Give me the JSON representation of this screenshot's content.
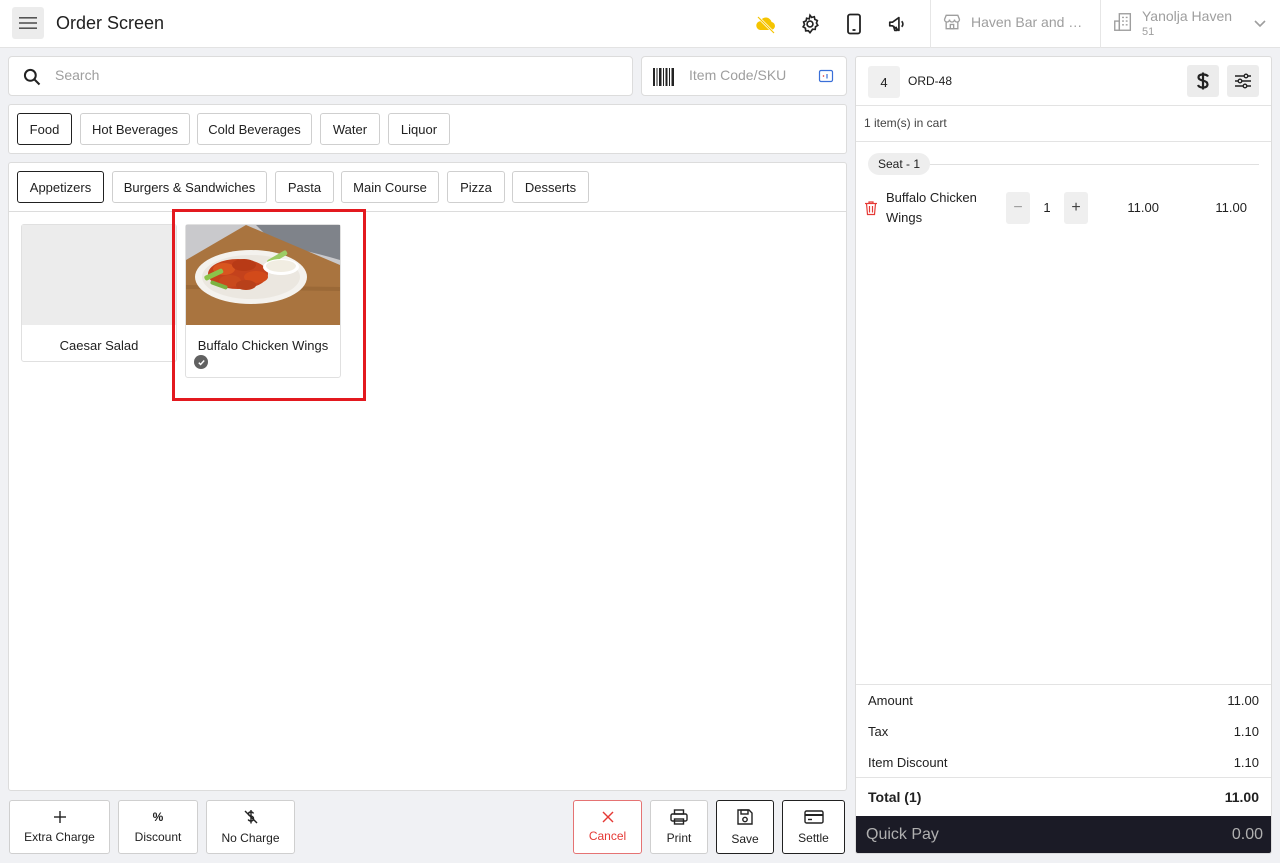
{
  "header": {
    "title": "Order Screen",
    "store_name": "Haven Bar and Restaurant",
    "location_name": "Yanolja Haven",
    "location_sub": "51"
  },
  "search": {
    "placeholder": "Search",
    "sku_placeholder": "Item Code/SKU"
  },
  "categories": [
    "Food",
    "Hot Beverages",
    "Cold Beverages",
    "Water",
    "Liquor"
  ],
  "active_category": "Food",
  "subcategories": [
    "Appetizers",
    "Burgers & Sandwiches",
    "Pasta",
    "Main Course",
    "Pizza",
    "Desserts"
  ],
  "active_subcategory": "Appetizers",
  "products": [
    {
      "name": "Caesar Salad",
      "has_image": false,
      "selected": false
    },
    {
      "name": "Buffalo Chicken Wings",
      "has_image": true,
      "selected": true
    }
  ],
  "actions": {
    "extra_charge": "Extra Charge",
    "discount": "Discount",
    "discount_symbol": "%",
    "no_charge": "No Charge",
    "cancel": "Cancel",
    "print": "Print",
    "save": "Save",
    "settle": "Settle"
  },
  "cart": {
    "table_no": "4",
    "order_id": "ORD-48",
    "count_text": "1 item(s) in cart",
    "seat_label": "Seat - 1",
    "items": [
      {
        "name": "Buffalo Chicken Wings",
        "qty": "1",
        "unit_price": "11.00",
        "total": "11.00"
      }
    ],
    "summary": {
      "amount_label": "Amount",
      "amount": "11.00",
      "tax_label": "Tax",
      "tax": "1.10",
      "discount_label": "Item Discount",
      "discount": "1.10",
      "total_label": "Total (1)",
      "total": "11.00"
    },
    "quick_pay_label": "Quick Pay",
    "quick_pay_value": "0.00"
  },
  "colors": {
    "accent_yellow": "#f5c400",
    "selection_red": "#e3191f",
    "delete_red": "#e53935",
    "quickpay_bg": "#1b1b26"
  }
}
